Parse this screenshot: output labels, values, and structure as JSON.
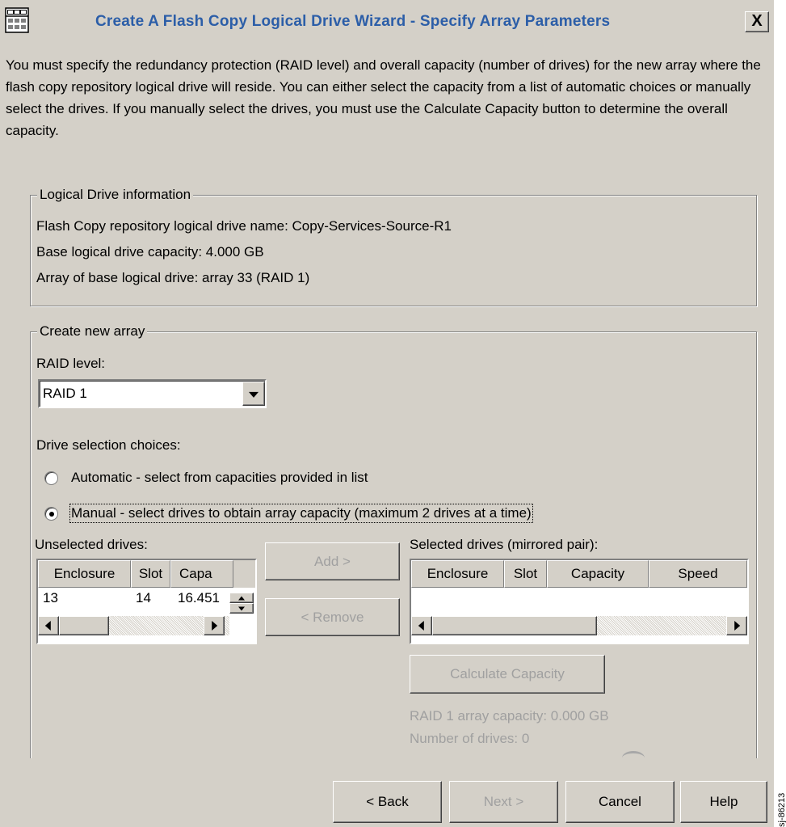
{
  "window": {
    "title": "Create A Flash Copy Logical Drive Wizard - Specify Array Parameters",
    "close_label": "X"
  },
  "intro_text": "You must specify the redundancy protection (RAID level) and overall capacity (number of drives) for the new array where the flash copy repository logical drive will reside. You can either select the capacity from a list of automatic choices or manually select the drives. If you manually select the drives, you must use the Calculate Capacity button to determine the overall capacity.",
  "logical_drive_info": {
    "legend": "Logical Drive information",
    "repository_name": "Flash Copy repository logical drive name: Copy-Services-Source-R1",
    "base_capacity": "Base logical drive capacity: 4.000 GB",
    "base_array": "Array of base logical drive: array 33 (RAID 1)"
  },
  "create_array": {
    "legend": "Create new array",
    "raid_label": "RAID level:",
    "raid_value": "RAID 1",
    "drive_selection_label": "Drive selection choices:",
    "option_automatic": "Automatic - select from capacities provided in list",
    "option_manual": "Manual - select drives to obtain array capacity (maximum 2 drives at a time)",
    "selected_option": "manual",
    "unselected_label": "Unselected drives:",
    "unselected_columns": [
      "Enclosure",
      "Slot",
      "Capa"
    ],
    "unselected_rows": [
      [
        "13",
        "14",
        "16.451"
      ]
    ],
    "selected_label": "Selected drives (mirrored pair):",
    "selected_columns": [
      "Enclosure",
      "Slot",
      "Capacity",
      "Speed"
    ],
    "selected_rows": [],
    "add_label": "Add >",
    "remove_label": "< Remove",
    "calculate_label": "Calculate Capacity",
    "array_capacity": "RAID 1 array capacity: 0.000 GB",
    "num_drives": "Number of drives: 0"
  },
  "footer": {
    "back_label": "< Back",
    "next_label": "Next >",
    "cancel_label": "Cancel",
    "help_label": "Help"
  },
  "side_code": "sj-86213",
  "colors": {
    "dialog_bg": "#d4d0c8",
    "title_text": "#2c5ea8",
    "disabled_text": "#a0a0a0"
  }
}
